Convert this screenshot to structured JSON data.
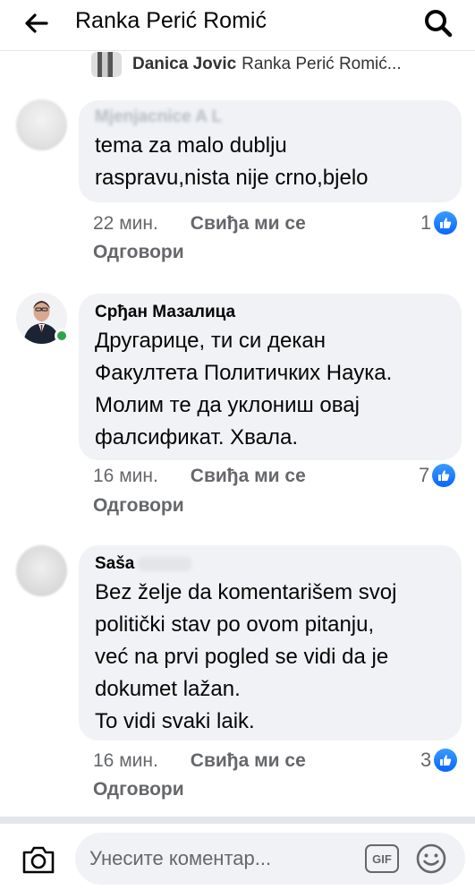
{
  "header": {
    "title": "Ranka Perić Romić"
  },
  "reply_preview": {
    "name": "Danica Jovic",
    "text": "Ranka Perić Romić..."
  },
  "comments": [
    {
      "author": "Mjenjacnice A L",
      "author_blurred": true,
      "text_lines": [
        "tema za malo dublju",
        "raspravu,nista nije crno,bjelo"
      ],
      "time": "22 мин.",
      "like_label": "Свиђа ми се",
      "reply_label": "Одговори",
      "reaction_count": "1"
    },
    {
      "author": "Срђан Мазалица",
      "author_blurred": false,
      "text_lines": [
        "Другарице, ти си декан",
        "Факултета Политичких Наука.",
        "Молим те да уклониш овај",
        "фалсификат. Хвала."
      ],
      "time": "16 мин.",
      "like_label": "Свиђа ми се",
      "reply_label": "Одговори",
      "reaction_count": "7"
    },
    {
      "author": "Saša",
      "author_blurred": false,
      "text_lines": [
        "Bez želje da komentarišem svoj",
        "politički stav po ovom pitanju,",
        "već na prvi pogled se vidi da je",
        "dokumet lažan.",
        "To vidi svaki laik."
      ],
      "time": "16 мин.",
      "like_label": "Свиђа ми се",
      "reply_label": "Одговори",
      "reaction_count": "3"
    }
  ],
  "composer": {
    "placeholder": "Унесите коментар...",
    "gif_label": "GIF"
  },
  "icons": {
    "back": "back-arrow-icon",
    "search": "search-icon",
    "camera": "camera-icon",
    "emoji": "emoji-icon",
    "like": "like-thumb-icon"
  },
  "colors": {
    "like_blue": "#0866ff",
    "online_green": "#31a24c",
    "bubble": "#f0f2f5",
    "meta_gray": "#65676b"
  }
}
